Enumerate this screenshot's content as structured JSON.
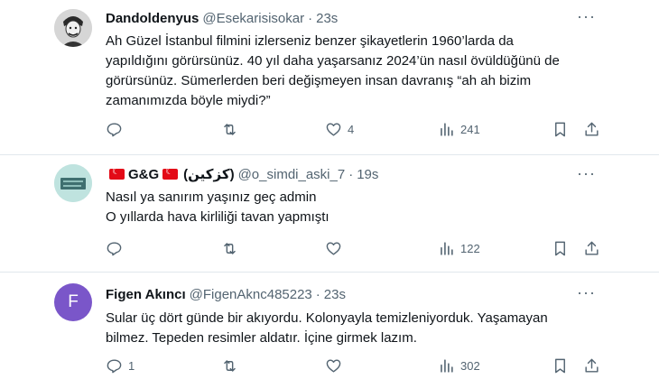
{
  "tweets": [
    {
      "name": "Dandoldenyus",
      "handle": "@Esekarisisokar",
      "dot": "·",
      "time": "23s",
      "lines": [
        "Ah Güzel İstanbul filmini izlerseniz benzer şikayetlerin 1960’larda da",
        "yapıldığını görürsünüz. 40 yıl daha yaşarsanız 2024’ün nasıl övüldüğünü de",
        "görürsünüz. Sümerlerden beri değişmeyen insan davranış “ah ah bizim",
        "zamanımızda böyle miydi?”"
      ],
      "replies": "",
      "retweets": "",
      "likes": "4",
      "views": "241"
    },
    {
      "name": "G&G",
      "handle_extra": "(كزكين)",
      "handle": "@o_simdi_aski_7",
      "dot": "·",
      "time": "19s",
      "lines": [
        "Nasıl ya sanırım yaşınız geç admin",
        "O yıllarda hava kirliliği tavan yapmıştı"
      ],
      "replies": "",
      "retweets": "",
      "likes": "",
      "views": "122"
    },
    {
      "avatar_letter": "F",
      "name": "Figen Akıncı",
      "handle": "@FigenAknc485223",
      "dot": "·",
      "time": "23s",
      "lines": [
        "Sular üç dört günde bir akıyordu. Kolonyayla temizleniyorduk. Yaşamayan",
        "bilmez. Tepeden resimler aldatır. İçine girmek lazım."
      ],
      "replies": "1",
      "retweets": "",
      "likes": "",
      "views": "302"
    }
  ],
  "icons": {
    "reply": "reply-icon",
    "retweet": "retweet-icon",
    "like": "heart-icon",
    "views": "views-icon",
    "bookmark": "bookmark-icon",
    "share": "share-icon",
    "more": "more-icon"
  },
  "colors": {
    "text": "#0f1419",
    "secondary": "#536471",
    "divider": "#e1e8ed",
    "avatar_f": "#7a56c9",
    "flag": "#e30a17"
  }
}
